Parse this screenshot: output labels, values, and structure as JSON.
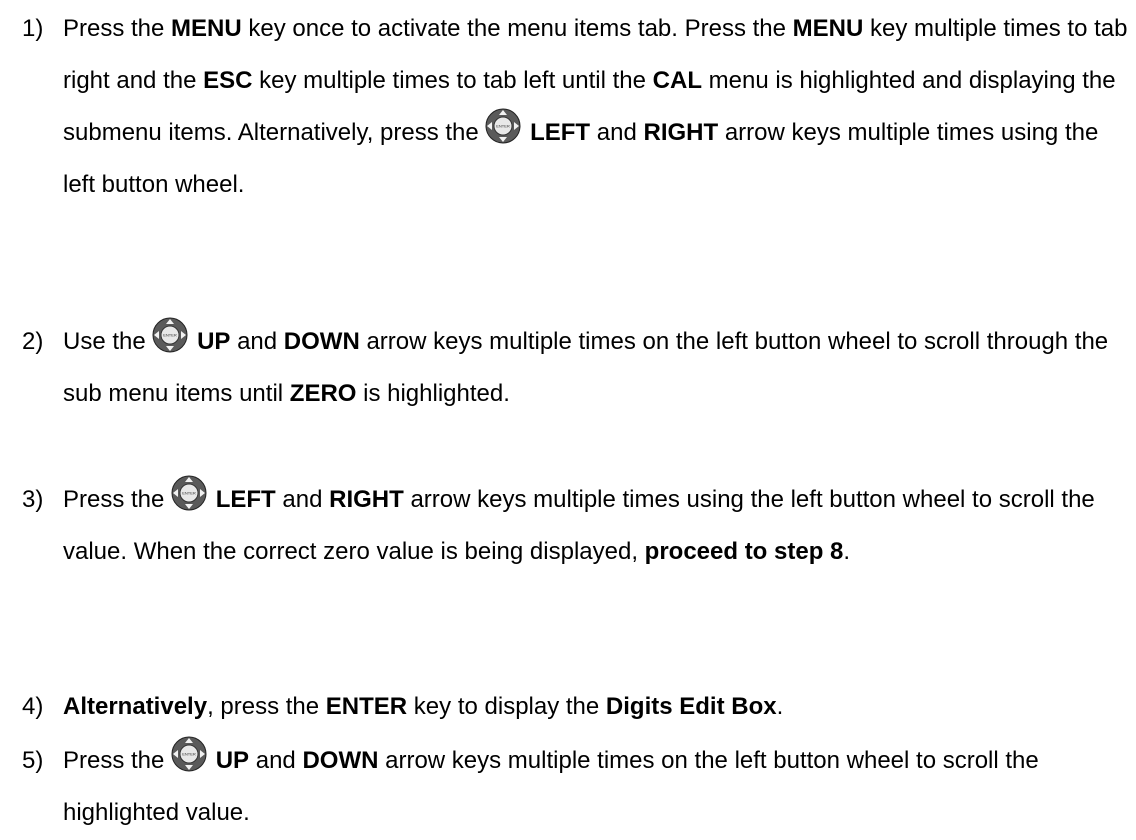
{
  "steps": [
    {
      "number": "1)",
      "segments": [
        {
          "t": "Press the ",
          "b": false
        },
        {
          "t": "MENU",
          "b": true
        },
        {
          "t": " key once to activate the menu items tab.  Press the ",
          "b": false
        },
        {
          "t": "MENU",
          "b": true
        },
        {
          "t": " key multiple times to tab right and the ",
          "b": false
        },
        {
          "t": "ESC",
          "b": true
        },
        {
          "t": " key multiple times to tab left until the ",
          "b": false
        },
        {
          "t": "CAL",
          "b": true
        },
        {
          "t": " menu is highlighted and displaying the submenu items. ",
          "b": false
        },
        {
          "t": "Alternatively, press the ",
          "b": false
        },
        {
          "icon": "wheel-icon"
        },
        {
          "t": " ",
          "b": false
        },
        {
          "t": "LEFT",
          "b": true
        },
        {
          "t": " and ",
          "b": false
        },
        {
          "t": "RIGHT",
          "b": true
        },
        {
          "t": " arrow keys multiple times using the left button wheel.",
          "b": false
        }
      ]
    },
    {
      "number": "2)",
      "segments": [
        {
          "t": "Use the ",
          "b": false
        },
        {
          "icon": "wheel-icon"
        },
        {
          "t": " ",
          "b": false
        },
        {
          "t": "UP",
          "b": true
        },
        {
          "t": " and ",
          "b": false
        },
        {
          "t": "DOWN",
          "b": true
        },
        {
          "t": " arrow keys multiple times on the left button wheel to scroll through the sub menu items until ",
          "b": false
        },
        {
          "t": "ZERO",
          "b": true
        },
        {
          "t": " is highlighted.",
          "b": false
        }
      ]
    },
    {
      "number": "3)",
      "segments": [
        {
          "t": "Press the ",
          "b": false
        },
        {
          "icon": "wheel-icon"
        },
        {
          "t": " ",
          "b": false
        },
        {
          "t": "LEFT",
          "b": true
        },
        {
          "t": " and ",
          "b": false
        },
        {
          "t": "RIGHT",
          "b": true
        },
        {
          "t": " arrow keys multiple times using the left button wheel to scroll the value.  When the correct zero value is being displayed, ",
          "b": false
        },
        {
          "t": "proceed to step 8",
          "b": true
        },
        {
          "t": ".",
          "b": false
        }
      ]
    },
    {
      "number": "4)",
      "segments": [
        {
          "t": "Alternatively",
          "b": true
        },
        {
          "t": ", press the ",
          "b": false
        },
        {
          "t": "ENTER",
          "b": true
        },
        {
          "t": " key to display the ",
          "b": false
        },
        {
          "t": "Digits Edit Box",
          "b": true
        },
        {
          "t": ".",
          "b": false
        }
      ]
    },
    {
      "number": "5)",
      "segments": [
        {
          "t": "Press the ",
          "b": false
        },
        {
          "icon": "wheel-icon"
        },
        {
          "t": " ",
          "b": false
        },
        {
          "t": "UP",
          "b": true
        },
        {
          "t": " and ",
          "b": false
        },
        {
          "t": "DOWN",
          "b": true
        },
        {
          "t": " arrow keys multiple times on the left button wheel to scroll the highlighted value.",
          "b": false
        }
      ]
    }
  ],
  "icon_label": "ENTER"
}
